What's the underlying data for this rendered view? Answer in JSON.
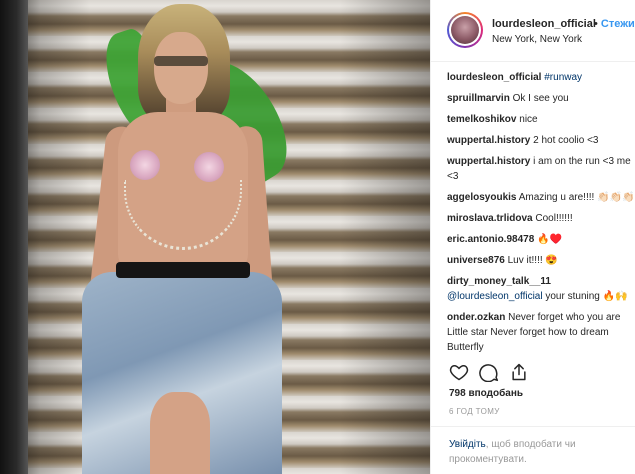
{
  "post": {
    "username": "lourdesleon_official",
    "separator": "•",
    "follow_label": "Стежити",
    "location": "New York, New York"
  },
  "caption": {
    "username": "lourdesleon_official",
    "hashtag": "#runway"
  },
  "comments": [
    {
      "user": "spruillmarvin",
      "text": "Ok I see you"
    },
    {
      "user": "temelkoshikov",
      "text": "nice"
    },
    {
      "user": "wuppertal.history",
      "text": "2 hot coolio <3"
    },
    {
      "user": "wuppertal.history",
      "text": "i am on the run <3 me <3"
    },
    {
      "user": "aggelosyoukis",
      "text": "Amazing u are!!!! 👏🏻👏🏻👏🏻"
    },
    {
      "user": "miroslava.trlidova",
      "text": "Cool!!!!!!"
    },
    {
      "user": "eric.antonio.98478",
      "text": "🔥♥️"
    },
    {
      "user": "universe876",
      "text": "Luv it!!!! 😍"
    },
    {
      "user": "dirty_money_talk__11",
      "mention": "@lourdesleon_official",
      "text": "your stuning 🔥🙌"
    },
    {
      "user": "onder.ozkan",
      "text": "Never forget who you are Little star Never forget how to dream Butterfly"
    }
  ],
  "likes_text": "798 вподобань",
  "time_text": "6 ГОД ТОМУ",
  "login": {
    "link": "Увійдіть",
    "text": ", щоб вподобати чи прокоментувати."
  },
  "icons": [
    "heart-icon",
    "comment-icon",
    "share-icon"
  ],
  "colors": {
    "link": "#003569",
    "follow": "#3897f0",
    "muted": "#999999",
    "border": "#efefef"
  }
}
